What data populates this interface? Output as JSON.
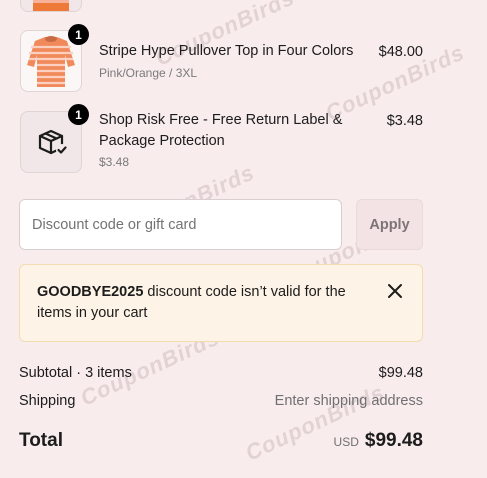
{
  "items": [
    {
      "title": "Stripe Hype Pullover Top in Four Colors",
      "variant": "Pink/Orange / 3XL",
      "price": "$48.00",
      "quantity": "1",
      "image": "striped-sweater-image"
    },
    {
      "title_line1": "Shop Risk Free - Free Return Label &",
      "title_line2": "Package Protection",
      "variant": "$3.48",
      "price": "$3.48",
      "quantity": "1",
      "icon": "package-check-icon"
    }
  ],
  "discount": {
    "placeholder": "Discount code or gift card",
    "apply_label": "Apply"
  },
  "notice": {
    "code": "GOODBYE2025",
    "message": " discount code isn’t valid for the items in your cart"
  },
  "summary": {
    "subtotal_label": "Subtotal · 3 items",
    "subtotal_value": "$99.48",
    "shipping_label": "Shipping",
    "shipping_value": "Enter shipping address",
    "total_label": "Total",
    "currency": "USD",
    "total_value": "$99.48"
  },
  "watermark": "CouponBirds",
  "colors": {
    "background": "#f8eced",
    "notice_bg": "#fdf3e6",
    "notice_border": "#f2dcb0",
    "apply_bg": "#f3e3e5"
  }
}
